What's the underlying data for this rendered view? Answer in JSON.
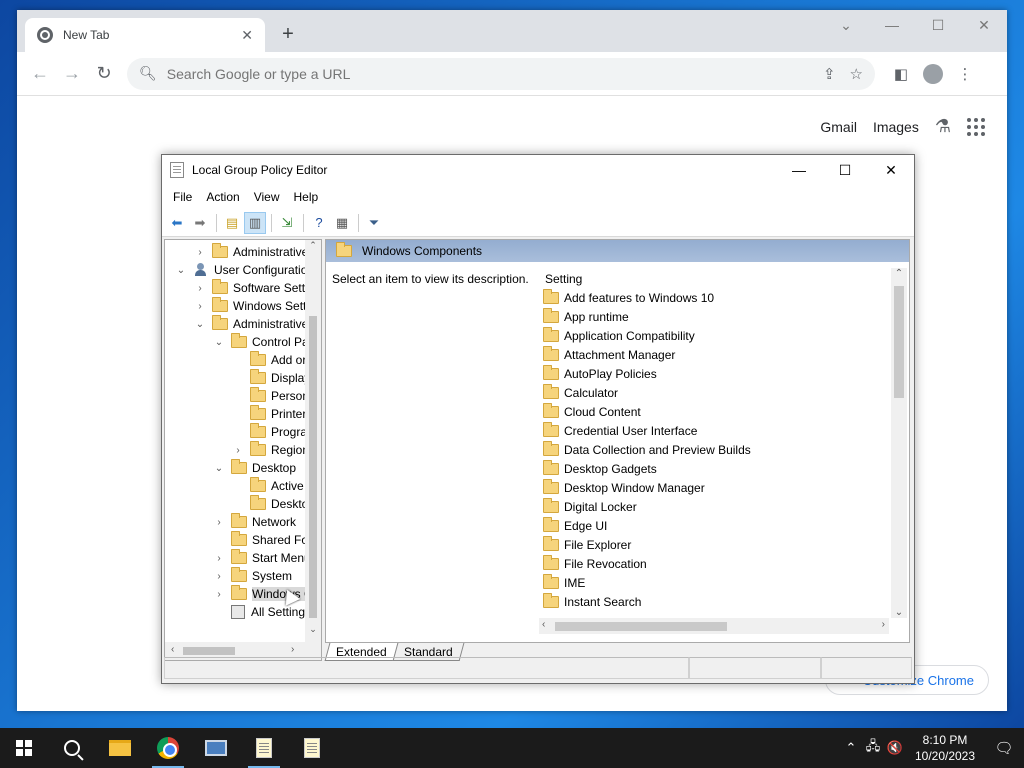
{
  "browser": {
    "tab_title": "New Tab",
    "new_tab": "+",
    "omnibox_placeholder": "Search Google or type a URL",
    "links": {
      "gmail": "Gmail",
      "images": "Images"
    },
    "customize_label": "Customize Chrome"
  },
  "gpedit": {
    "title": "Local Group Policy Editor",
    "menu": [
      "File",
      "Action",
      "View",
      "Help"
    ],
    "tree": [
      {
        "label": "Administrative Templates",
        "depth": 1,
        "toggle": ">"
      },
      {
        "label": "User Configuration",
        "depth": 0,
        "toggle": "v"
      },
      {
        "label": "Software Settings",
        "depth": 1,
        "toggle": ">"
      },
      {
        "label": "Windows Settings",
        "depth": 1,
        "toggle": ">"
      },
      {
        "label": "Administrative Templates",
        "depth": 1,
        "toggle": "v"
      },
      {
        "label": "Control Panel",
        "depth": 2,
        "toggle": "v"
      },
      {
        "label": "Add or Remove Programs",
        "depth": 3,
        "toggle": ""
      },
      {
        "label": "Display",
        "depth": 3,
        "toggle": ""
      },
      {
        "label": "Personalization",
        "depth": 3,
        "toggle": ""
      },
      {
        "label": "Printers",
        "depth": 3,
        "toggle": ""
      },
      {
        "label": "Programs",
        "depth": 3,
        "toggle": ""
      },
      {
        "label": "Regional and Language Options",
        "depth": 3,
        "toggle": ">"
      },
      {
        "label": "Desktop",
        "depth": 2,
        "toggle": "v"
      },
      {
        "label": "Active Desktop",
        "depth": 3,
        "toggle": ""
      },
      {
        "label": "Desktop",
        "depth": 3,
        "toggle": ""
      },
      {
        "label": "Network",
        "depth": 2,
        "toggle": ">"
      },
      {
        "label": "Shared Folders",
        "depth": 2,
        "toggle": ""
      },
      {
        "label": "Start Menu and Taskbar",
        "depth": 2,
        "toggle": ">"
      },
      {
        "label": "System",
        "depth": 2,
        "toggle": ">"
      },
      {
        "label": "Windows Components",
        "depth": 2,
        "toggle": ">",
        "selected": true
      },
      {
        "label": "All Settings",
        "depth": 2,
        "toggle": ""
      }
    ],
    "pane_title": "Windows Components",
    "description": "Select an item to view its description.",
    "column_header": "Setting",
    "items": [
      "Add features to Windows 10",
      "App runtime",
      "Application Compatibility",
      "Attachment Manager",
      "AutoPlay Policies",
      "Calculator",
      "Cloud Content",
      "Credential User Interface",
      "Data Collection and Preview Builds",
      "Desktop Gadgets",
      "Desktop Window Manager",
      "Digital Locker",
      "Edge UI",
      "File Explorer",
      "File Revocation",
      "IME",
      "Instant Search"
    ],
    "tabs": [
      "Extended",
      "Standard"
    ]
  },
  "taskbar": {
    "time": "8:10 PM",
    "date": "10/20/2023"
  }
}
